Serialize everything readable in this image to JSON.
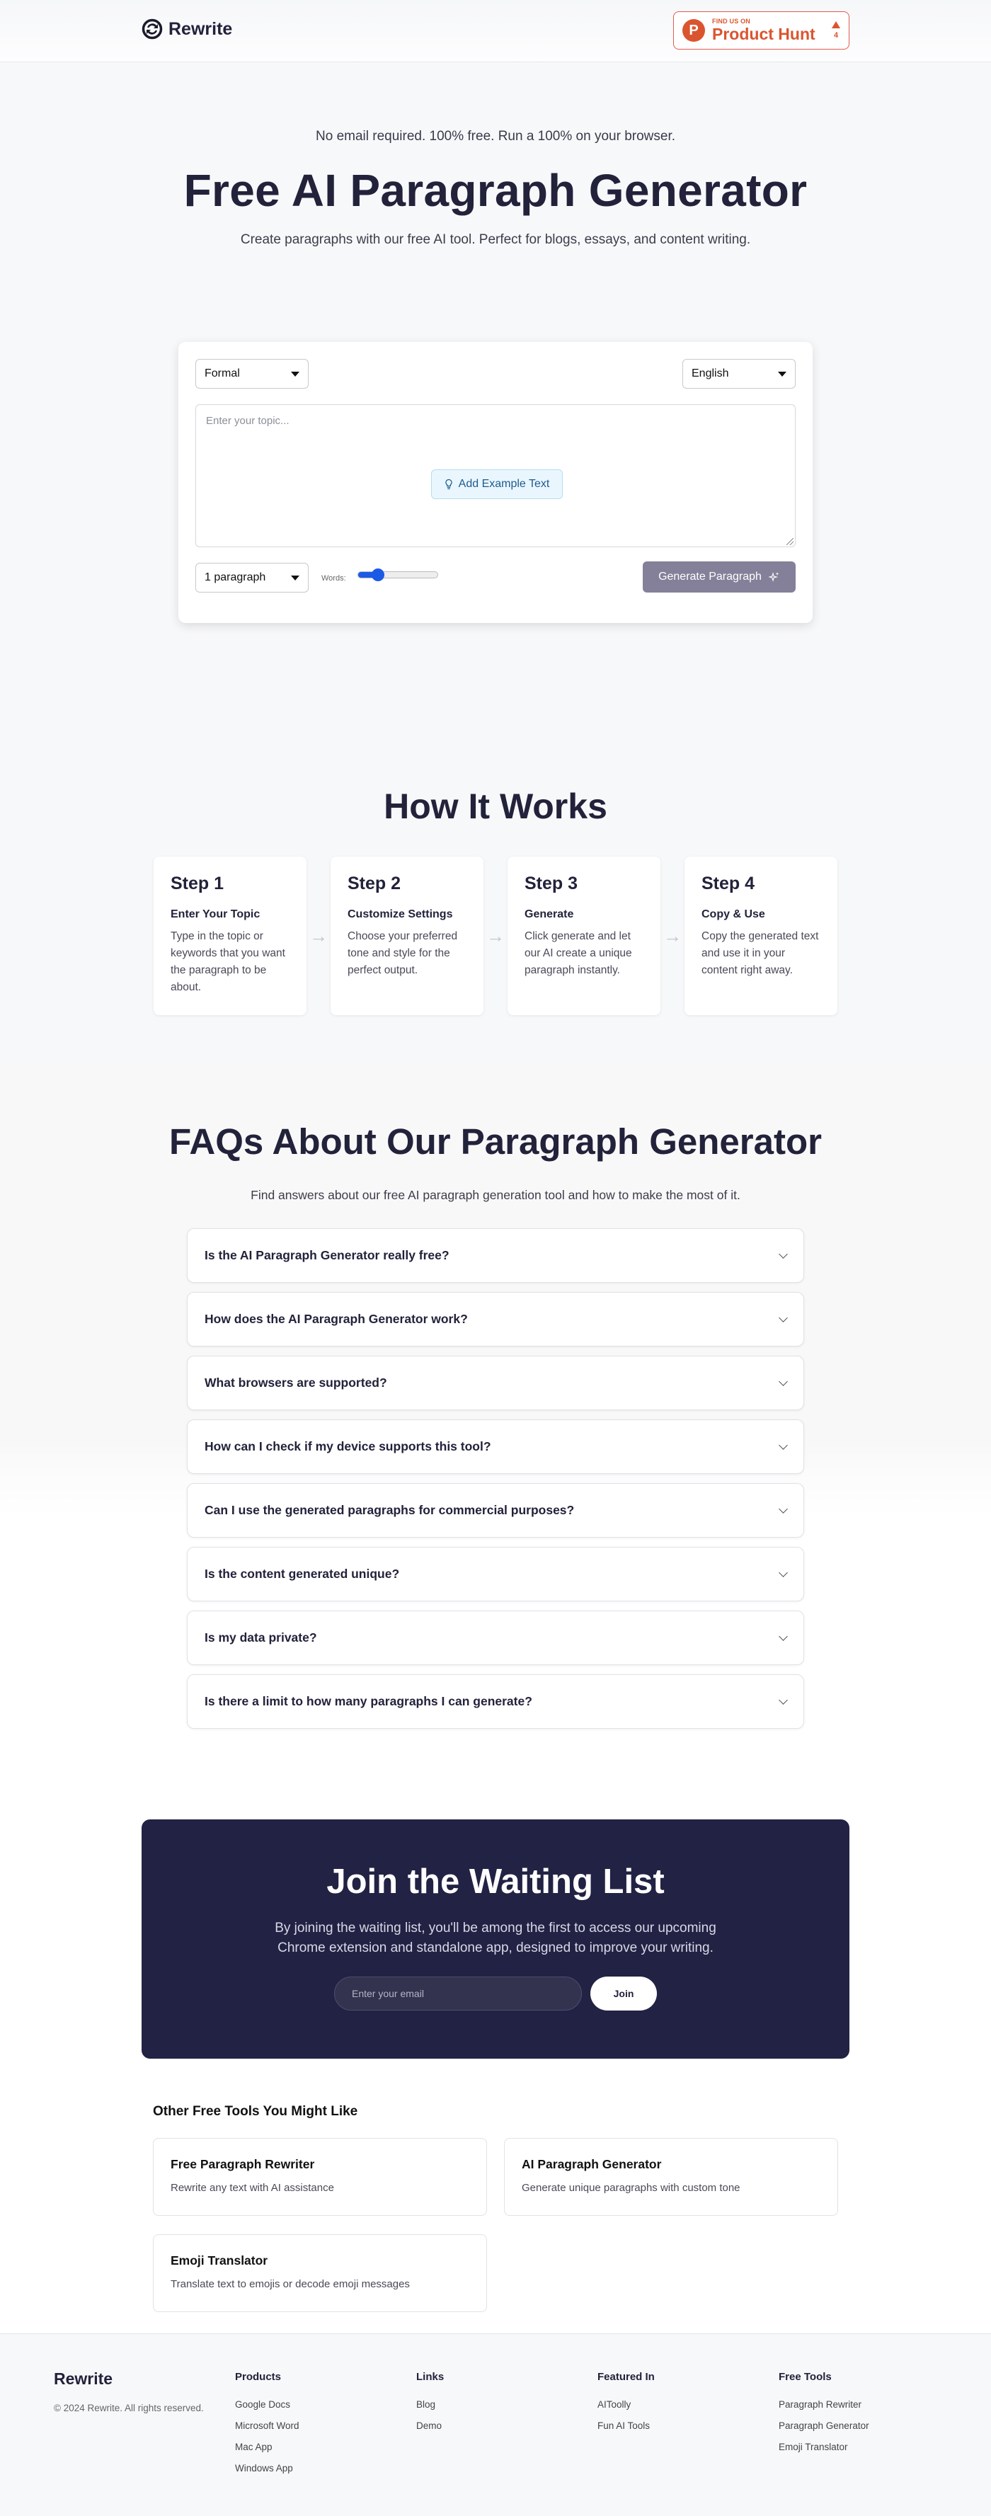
{
  "header": {
    "logo_text": "Rewrite",
    "product_hunt": {
      "small_label": "FIND US ON",
      "big_label": "Product Hunt",
      "votes": "4",
      "color": "#da552f"
    }
  },
  "hero": {
    "tagline": "No email required. 100% free. Run a 100% on your browser.",
    "title": "Free AI Paragraph Generator",
    "subtitle": "Create paragraphs with our free AI tool. Perfect for blogs, essays, and content writing."
  },
  "tool": {
    "tone_select": {
      "value": "Formal"
    },
    "language_select": {
      "value": "English"
    },
    "topic_input": {
      "placeholder": "Enter your topic...",
      "value": ""
    },
    "example_button_label": "Add Example Text",
    "paragraph_count_select": {
      "value": "1 paragraph"
    },
    "words_label": "Words:",
    "words_slider": {
      "fraction": 0.25,
      "color": "#1a5ae6"
    },
    "generate_button_label": "Generate Paragraph"
  },
  "how_it_works": {
    "title": "How It Works",
    "steps": [
      {
        "number": "Step 1",
        "name": "Enter Your Topic",
        "description": "Type in the topic or keywords that you want the paragraph to be about."
      },
      {
        "number": "Step 2",
        "name": "Customize Settings",
        "description": "Choose your preferred tone and style for the perfect output."
      },
      {
        "number": "Step 3",
        "name": "Generate",
        "description": "Click generate and let our AI create a unique paragraph instantly."
      },
      {
        "number": "Step 4",
        "name": "Copy & Use",
        "description": "Copy the generated text and use it in your content right away."
      }
    ]
  },
  "faq": {
    "title": "FAQs About Our Paragraph Generator",
    "subtitle": "Find answers about our free AI paragraph generation tool and how to make the most of it.",
    "items": [
      "Is the AI Paragraph Generator really free?",
      "How does the AI Paragraph Generator work?",
      "What browsers are supported?",
      "How can I check if my device supports this tool?",
      "Can I use the generated paragraphs for commercial purposes?",
      "Is the content generated unique?",
      "Is my data private?",
      "Is there a limit to how many paragraphs I can generate?"
    ]
  },
  "waitlist": {
    "title": "Join the Waiting List",
    "description": "By joining the waiting list, you'll be among the first to access our upcoming Chrome extension and standalone app, designed to improve your writing.",
    "email_placeholder": "Enter your email",
    "join_label": "Join",
    "background_color": "#222244"
  },
  "other_tools": {
    "title": "Other Free Tools You Might Like",
    "items": [
      {
        "name": "Free Paragraph Rewriter",
        "description": "Rewrite any text with AI assistance"
      },
      {
        "name": "AI Paragraph Generator",
        "description": "Generate unique paragraphs with custom tone"
      },
      {
        "name": "Emoji Translator",
        "description": "Translate text to emojis or decode emoji messages"
      }
    ]
  },
  "footer": {
    "logo_text": "Rewrite",
    "copyright": "© 2024 Rewrite. All rights reserved.",
    "columns": [
      {
        "title": "Products",
        "links": [
          "Google Docs",
          "Microsoft Word",
          "Mac App",
          "Windows App"
        ]
      },
      {
        "title": "Links",
        "links": [
          "Blog",
          "Demo"
        ]
      },
      {
        "title": "Featured In",
        "links": [
          "AIToolly",
          "Fun AI Tools"
        ]
      },
      {
        "title": "Free Tools",
        "links": [
          "Paragraph Rewriter",
          "Paragraph Generator",
          "Emoji Translator"
        ]
      }
    ]
  }
}
